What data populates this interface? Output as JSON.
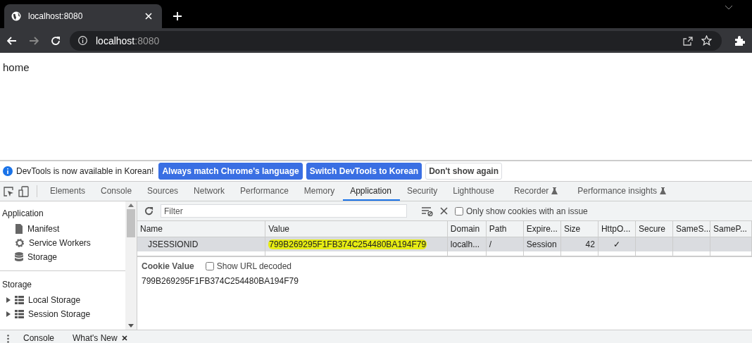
{
  "browser": {
    "tab_title": "localhost:8080",
    "address_host": "localhost",
    "address_port": ":8080"
  },
  "page": {
    "text": "home"
  },
  "infobar": {
    "message": "DevTools is now available in Korean!",
    "buttons": [
      {
        "label": "Always match Chrome's language",
        "primary": true
      },
      {
        "label": "Switch DevTools to Korean",
        "primary": true
      },
      {
        "label": "Don't show again",
        "primary": false
      }
    ]
  },
  "devtools_tabs": [
    {
      "label": "Elements",
      "selected": false,
      "experimental": false
    },
    {
      "label": "Console",
      "selected": false,
      "experimental": false
    },
    {
      "label": "Sources",
      "selected": false,
      "experimental": false
    },
    {
      "label": "Network",
      "selected": false,
      "experimental": false
    },
    {
      "label": "Performance",
      "selected": false,
      "experimental": false
    },
    {
      "label": "Memory",
      "selected": false,
      "experimental": false
    },
    {
      "label": "Application",
      "selected": true,
      "experimental": false
    },
    {
      "label": "Security",
      "selected": false,
      "experimental": false
    },
    {
      "label": "Lighthouse",
      "selected": false,
      "experimental": false
    },
    {
      "label": "Recorder",
      "selected": false,
      "experimental": true
    },
    {
      "label": "Performance insights",
      "selected": false,
      "experimental": true
    }
  ],
  "sidebar": {
    "sections": [
      {
        "title": "Application",
        "items": [
          {
            "label": "Manifest",
            "kind": "file",
            "expandable": false
          },
          {
            "label": "Service Workers",
            "kind": "gear",
            "expandable": false
          },
          {
            "label": "Storage",
            "kind": "database",
            "expandable": false
          }
        ]
      },
      {
        "title": "Storage",
        "items": [
          {
            "label": "Local Storage",
            "kind": "grid",
            "expandable": true
          },
          {
            "label": "Session Storage",
            "kind": "grid",
            "expandable": true
          }
        ]
      }
    ]
  },
  "toolbar": {
    "filter_placeholder": "Filter",
    "issue_checkbox": {
      "label": "Only show cookies with an issue",
      "checked": false
    }
  },
  "table": {
    "columns": [
      "Name",
      "Value",
      "Domain",
      "Path",
      "Expire...",
      "Size",
      "HttpO...",
      "Secure",
      "SameS...",
      "SameP..."
    ],
    "rows": [
      {
        "selected": true,
        "highlighted_value": true,
        "cells": [
          "JSESSIONID",
          "799B269295F1FB374C254480BA194F79",
          "localh...",
          "/",
          "Session",
          "42",
          "✓",
          "",
          "",
          ""
        ]
      }
    ]
  },
  "cookie_value": {
    "title": "Cookie Value",
    "decode_checkbox": {
      "label": "Show URL decoded",
      "checked": false
    },
    "value": "799B269295F1FB374C254480BA194F79"
  },
  "drawer_tabs": [
    {
      "label": "Console",
      "closable": false
    },
    {
      "label": "What's New",
      "closable": true
    }
  ]
}
